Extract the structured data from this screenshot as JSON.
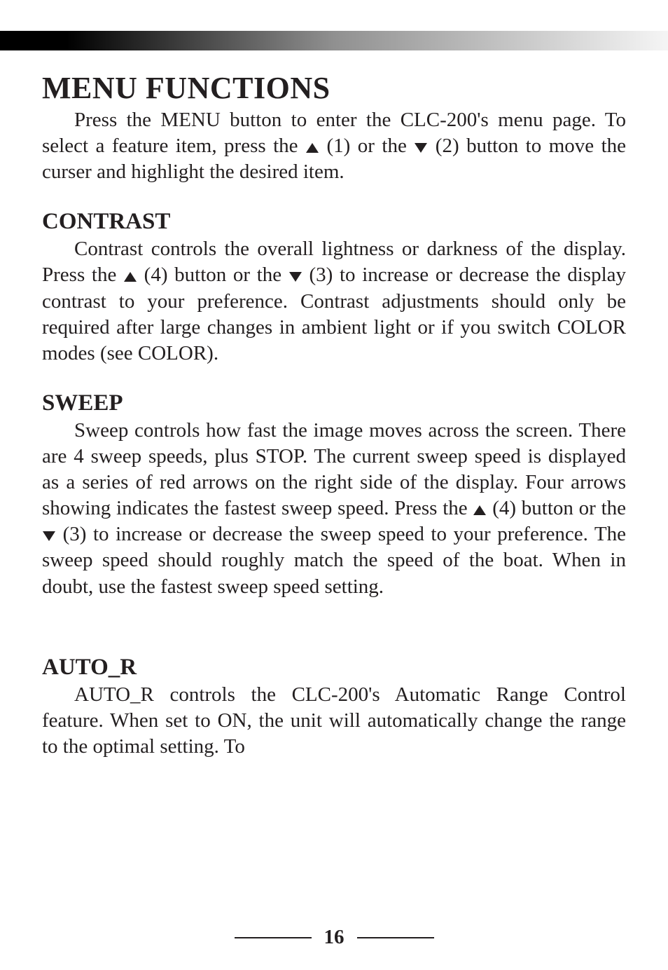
{
  "title": "MENU FUNCTIONS",
  "intro": {
    "p1": "Press the MENU button to enter the CLC-200's menu page. To select a feature item, press the ",
    "p2": " (1) or the ",
    "p3": " (2) button to move the curser and highlight the desired item."
  },
  "sections": [
    {
      "heading": "CONTRAST",
      "p1": "Contrast controls the overall lightness or darkness of the display. Press the ",
      "p2": " (4) button or the ",
      "p3": " (3) to increase or decrease the display contrast to your preference. Contrast adjustments should only be required after large changes in ambient light or if you switch COLOR modes (see COLOR)."
    },
    {
      "heading": "SWEEP",
      "p1": "Sweep controls how fast the image moves across the screen. There are 4 sweep speeds, plus STOP. The current sweep speed is displayed as a series of red arrows on the right side of the display. Four arrows showing indicates the fastest sweep speed. Press the ",
      "p2": " (4) button or the ",
      "p3": " (3) to increase or decrease the sweep speed to your preference. The sweep speed should roughly match the speed of the boat. When in doubt, use the fastest sweep speed setting."
    },
    {
      "heading": "AUTO_R",
      "p1": "AUTO_R controls the CLC-200's Automatic Range Control feature. When set to ON, the unit will automatically change the range to the optimal setting. To"
    }
  ],
  "page_number": "16"
}
